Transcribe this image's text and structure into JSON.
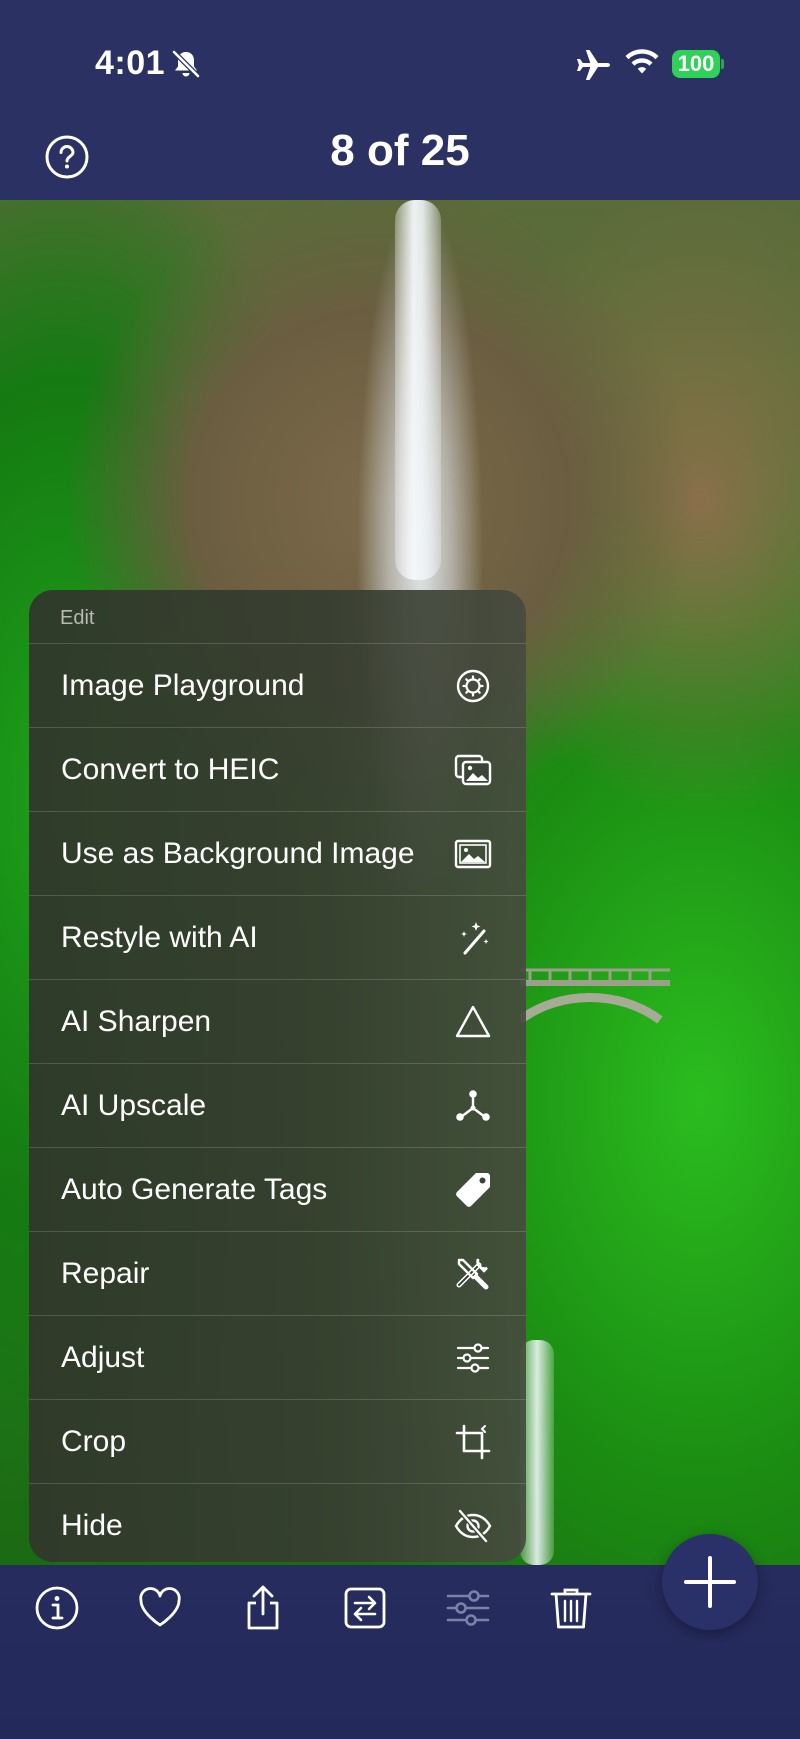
{
  "status_bar": {
    "time": "4:01",
    "battery": "100",
    "icons": [
      "bell-slash-icon",
      "airplane-icon",
      "wifi-icon",
      "battery-icon"
    ]
  },
  "nav": {
    "title": "8 of 25",
    "help_icon": "question-circle-icon"
  },
  "menu": {
    "header": "Edit",
    "items": [
      {
        "label": "Image Playground",
        "icon": "image-playground-icon"
      },
      {
        "label": "Convert to HEIC",
        "icon": "photos-stack-icon"
      },
      {
        "label": "Use as Background Image",
        "icon": "photo-frame-icon"
      },
      {
        "label": "Restyle with AI",
        "icon": "magic-wand-icon"
      },
      {
        "label": "AI Sharpen",
        "icon": "triangle-icon"
      },
      {
        "label": "AI Upscale",
        "icon": "nodes-icon"
      },
      {
        "label": "Auto Generate Tags",
        "icon": "tag-icon"
      },
      {
        "label": "Repair",
        "icon": "tools-icon"
      },
      {
        "label": "Adjust",
        "icon": "sliders-icon"
      },
      {
        "label": "Crop",
        "icon": "crop-icon"
      },
      {
        "label": "Hide",
        "icon": "eye-slash-icon"
      }
    ]
  },
  "toolbar": {
    "buttons": [
      "info-icon",
      "heart-icon",
      "share-icon",
      "swap-icon",
      "adjust-sliders-icon",
      "trash-icon"
    ],
    "fab_icon": "plus-icon"
  },
  "colors": {
    "bar_background": "#2b3163",
    "battery_green": "#2fd158",
    "menu_background": "#37402f"
  }
}
